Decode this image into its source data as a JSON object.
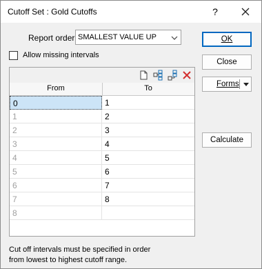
{
  "window": {
    "title": "Cutoff Set : Gold Cutoffs",
    "help_label": "?"
  },
  "form": {
    "report_order_label": "Report order",
    "report_order_value": "SMALLEST VALUE UP",
    "allow_missing_label": "Allow missing intervals",
    "allow_missing_checked": false
  },
  "buttons": {
    "ok": "OK",
    "close": "Close",
    "forms": "Forms",
    "calculate": "Calculate"
  },
  "grid": {
    "columns": [
      "From",
      "To"
    ],
    "rows": [
      {
        "from": "0",
        "to": "1"
      },
      {
        "from": "1",
        "to": "2"
      },
      {
        "from": "2",
        "to": "3"
      },
      {
        "from": "3",
        "to": "4"
      },
      {
        "from": "4",
        "to": "5"
      },
      {
        "from": "5",
        "to": "6"
      },
      {
        "from": "6",
        "to": "7"
      },
      {
        "from": "7",
        "to": "8"
      },
      {
        "from": "8",
        "to": ""
      }
    ],
    "toolbar_icons": [
      "new-file-icon",
      "insert-rows-icon",
      "append-rows-icon",
      "delete-icon"
    ]
  },
  "footer": {
    "line1": "Cut off intervals must be specified in order",
    "line2": "from lowest to highest cutoff range."
  },
  "colors": {
    "accent": "#0067c0",
    "delete_icon": "#d32f2f",
    "selected_cell": "#cce4f7"
  }
}
